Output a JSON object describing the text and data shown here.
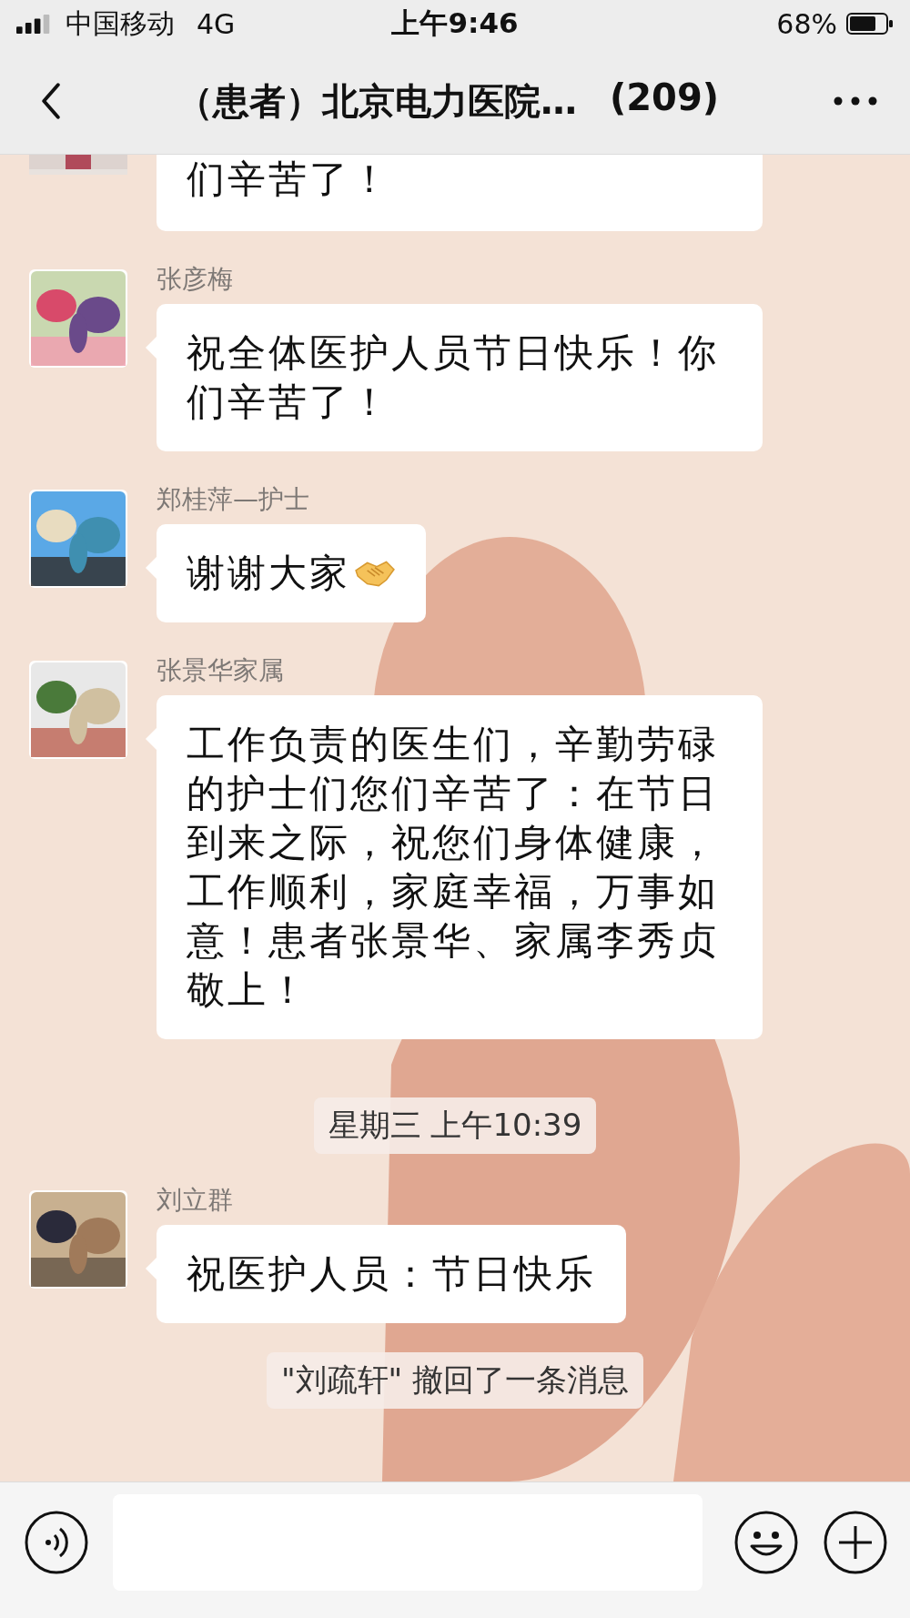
{
  "status_bar": {
    "carrier": "中国移动",
    "network": "4G",
    "time": "上午9:46",
    "battery": "68%"
  },
  "nav": {
    "title": "（患者）北京电力医院…",
    "member_count": "(209)"
  },
  "timeline": [
    {
      "kind": "partial",
      "text": "们辛苦了！"
    },
    {
      "kind": "message",
      "sender": "张彦梅",
      "text": "祝全体医护人员节日快乐！你们辛苦了！"
    },
    {
      "kind": "message",
      "sender": "郑桂萍—护士",
      "text": "谢谢大家",
      "trailing_icon": true
    },
    {
      "kind": "message",
      "sender": "张景华家属",
      "text": "工作负责的医生们，辛勤劳碌的护士们您们辛苦了：在节日到来之际，祝您们身体健康，工作顺利，家庭幸福，万事如意！患者张景华、家属李秀贞敬上！"
    },
    {
      "kind": "time",
      "text": "星期三 上午10:39"
    },
    {
      "kind": "message",
      "sender": "刘立群",
      "text": "祝医护人员：节日快乐"
    },
    {
      "kind": "notice",
      "text": "\"刘疏轩\" 撤回了一条消息"
    }
  ]
}
